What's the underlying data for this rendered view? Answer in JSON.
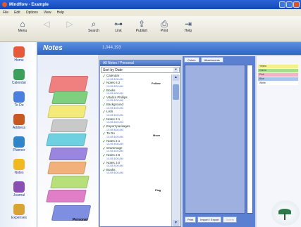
{
  "window": {
    "title": "Mindflow - Example"
  },
  "menu": [
    "File",
    "Edit",
    "Options",
    "View",
    "Help"
  ],
  "toolbar": [
    {
      "label": "Menu",
      "icon": "home-icon",
      "enabled": true
    },
    {
      "label": "",
      "icon": "back-icon",
      "enabled": false
    },
    {
      "label": "",
      "icon": "forward-icon",
      "enabled": false
    },
    {
      "label": "Search",
      "icon": "search-icon",
      "enabled": true
    },
    {
      "label": "Link",
      "icon": "link-icon",
      "enabled": true
    },
    {
      "label": "Publish",
      "icon": "publish-icon",
      "enabled": true
    },
    {
      "label": "Print",
      "icon": "print-icon",
      "enabled": true
    },
    {
      "label": "Help",
      "icon": "help-icon",
      "enabled": true
    }
  ],
  "sidebar": [
    {
      "label": "Home",
      "color": "#e65a3a"
    },
    {
      "label": "Calendar",
      "color": "#3aa05a"
    },
    {
      "label": "To Do",
      "color": "#4a7fe0"
    },
    {
      "label": "Address",
      "color": "#c9581f"
    },
    {
      "label": "Planner",
      "color": "#2f85c9"
    },
    {
      "label": "Notes",
      "color": "#f2b823"
    },
    {
      "label": "Journal",
      "color": "#8a4fb5"
    },
    {
      "label": "Expenses",
      "color": "#d9a431"
    }
  ],
  "header": {
    "title": "Notes",
    "subtitle": "1,044,193"
  },
  "stack": {
    "layers": [
      "#f07f7f",
      "#7ed07e",
      "#f4ea79",
      "#c9c9c9",
      "#6ed0e0",
      "#9a86e0",
      "#f2b07a",
      "#b8e07a",
      "#e07ec8",
      "#7e8ee0"
    ],
    "label": "Personal"
  },
  "notelist": {
    "header": "All Notes / Personal",
    "sort": "Sort by Date",
    "items": [
      {
        "name": "Calendar",
        "date": "1/1/05 8:00 AM"
      },
      {
        "name": "Notes 6.2",
        "date": "1/1/05 8:00 AM"
      },
      {
        "name": "Books",
        "date": "1/1/05 8:00 AM"
      },
      {
        "name": "Vitalics Phillips",
        "date": "1/1/05 8:00 AM"
      },
      {
        "name": "Background",
        "date": "1/1/05 8:00 AM"
      },
      {
        "name": "Lists",
        "date": "1/1/05 8:00 AM"
      },
      {
        "name": "Notes 2.1",
        "date": "1/1/05 8:00 AM"
      },
      {
        "name": "Export packages",
        "date": "1/1/05 8:00 AM"
      },
      {
        "name": "To Do",
        "date": "1/1/05 8:00 AM"
      },
      {
        "name": "Notes 2.1",
        "date": "1/1/05 8:00 AM"
      },
      {
        "name": "Grammage",
        "date": "1/1/05 8:00 AM"
      },
      {
        "name": "Notes 2.6",
        "date": "1/1/05 8:00 AM"
      },
      {
        "name": "Notes 3.0",
        "date": "1/1/05 8:00 AM"
      },
      {
        "name": "Books",
        "date": "1/1/05 8:00 AM"
      }
    ],
    "side_buttons": {
      "follow": "Follow",
      "move": "Move",
      "flag": "Flag"
    }
  },
  "editor": {
    "tabs": [
      "Colors",
      "Attachments"
    ],
    "bottom": [
      {
        "label": "Print",
        "enabled": true
      },
      {
        "label": "Import / Export",
        "enabled": true
      },
      {
        "label": "Delete",
        "enabled": false
      }
    ]
  },
  "tags": [
    {
      "label": "Yellow",
      "color": "#f6f08a"
    },
    {
      "label": "Green",
      "color": "#9fe28a"
    },
    {
      "label": "Pink",
      "color": "#f5b3c9"
    },
    {
      "label": "Blue",
      "color": "#a9c6f0"
    },
    {
      "label": "White",
      "color": "#ffffff"
    }
  ]
}
